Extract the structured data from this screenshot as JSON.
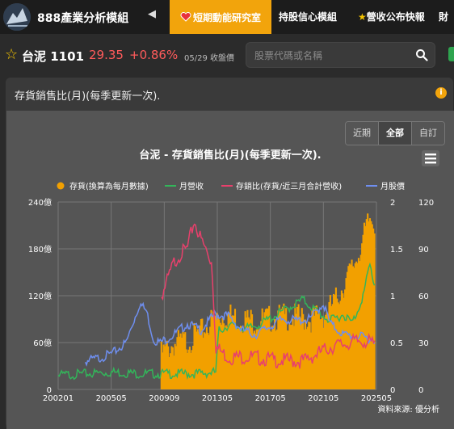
{
  "app": {
    "brand": "888產業分析模組",
    "nav_arrow": "◀"
  },
  "nav": {
    "active_tab": "短期動能研究室",
    "tabs": [
      "持股信心模組",
      "營收公布快報",
      "財"
    ]
  },
  "stock": {
    "name": "台泥 1101",
    "price": "29.35",
    "change": "+0.86%",
    "date": "05/29 收盤價"
  },
  "search": {
    "placeholder": "股票代碼或名稱"
  },
  "panel": {
    "title": "存貨銷售比(月)(每季更新一次)."
  },
  "range_buttons": [
    "近期",
    "全部",
    "自訂"
  ],
  "colors": {
    "inventory": "#f2a000",
    "revenue": "#33b55a",
    "ratio": "#e8406c",
    "price": "#6f8ff0",
    "accent": "#f2a40c"
  },
  "chart_data": {
    "type": "bar+line",
    "title": "台泥 - 存貨銷售比(月)(每季更新一次).",
    "source": "資料來源: 優分析",
    "legend": [
      "存貨(換算為每月數據)",
      "月營收",
      "存銷比(存貨/近三月合計營收)",
      "月股價"
    ],
    "legend_position": "top",
    "x_ticks": [
      "200201",
      "200505",
      "200909",
      "201305",
      "201705",
      "202105",
      "202505"
    ],
    "x_range": [
      2002.0,
      2025.4
    ],
    "left_axis": {
      "ticks": [
        "0",
        "60億",
        "120億",
        "180億",
        "240億"
      ],
      "range": [
        0,
        240
      ],
      "unit": "億"
    },
    "right_axis_1": {
      "ticks": [
        "0",
        "0.5",
        "1",
        "1.5",
        "2"
      ],
      "range": [
        0,
        2
      ]
    },
    "right_axis_2": {
      "ticks": [
        "0",
        "30",
        "60",
        "90",
        "120"
      ],
      "range": [
        0,
        120
      ]
    },
    "grid": true,
    "series": [
      {
        "name": "存貨(換算為每月數據)",
        "axis": "left",
        "type": "bar",
        "points": [
          [
            2009.6,
            45
          ],
          [
            2010.5,
            58
          ],
          [
            2011.5,
            62
          ],
          [
            2012.5,
            72
          ],
          [
            2013.5,
            92
          ],
          [
            2014.5,
            95
          ],
          [
            2015.5,
            90
          ],
          [
            2016.5,
            88
          ],
          [
            2017.5,
            90
          ],
          [
            2018.5,
            93
          ],
          [
            2019.5,
            92
          ],
          [
            2020.5,
            90
          ],
          [
            2021.5,
            95
          ],
          [
            2022.3,
            110
          ],
          [
            2022.9,
            130
          ],
          [
            2023.5,
            150
          ],
          [
            2024.0,
            170
          ],
          [
            2024.5,
            195
          ],
          [
            2024.9,
            218
          ],
          [
            2025.3,
            215
          ]
        ]
      },
      {
        "name": "月營收",
        "axis": "left",
        "type": "line",
        "points": [
          [
            2002.0,
            18
          ],
          [
            2004.0,
            20
          ],
          [
            2006.0,
            22
          ],
          [
            2008.0,
            20
          ],
          [
            2010.0,
            20
          ],
          [
            2012.0,
            20
          ],
          [
            2013.6,
            22
          ],
          [
            2013.8,
            75
          ],
          [
            2014.5,
            82
          ],
          [
            2016.0,
            78
          ],
          [
            2017.0,
            85
          ],
          [
            2018.0,
            95
          ],
          [
            2019.0,
            105
          ],
          [
            2020.0,
            115
          ],
          [
            2021.0,
            100
          ],
          [
            2022.0,
            88
          ],
          [
            2023.0,
            96
          ],
          [
            2023.6,
            85
          ],
          [
            2024.0,
            100
          ],
          [
            2024.5,
            125
          ],
          [
            2024.9,
            160
          ],
          [
            2025.3,
            130
          ]
        ]
      },
      {
        "name": "存銷比(存貨/近三月合計營收)",
        "axis": "right1",
        "type": "line",
        "points": [
          [
            2009.6,
            1.0
          ],
          [
            2010.0,
            1.15
          ],
          [
            2010.5,
            1.35
          ],
          [
            2011.0,
            1.45
          ],
          [
            2011.5,
            1.5
          ],
          [
            2012.0,
            1.8
          ],
          [
            2012.5,
            1.6
          ],
          [
            2013.0,
            1.45
          ],
          [
            2013.3,
            1.35
          ],
          [
            2013.6,
            0.45
          ],
          [
            2014.5,
            0.34
          ],
          [
            2016.0,
            0.35
          ],
          [
            2018.0,
            0.31
          ],
          [
            2020.0,
            0.3
          ],
          [
            2022.0,
            0.45
          ],
          [
            2023.5,
            0.5
          ],
          [
            2024.5,
            0.52
          ],
          [
            2025.3,
            0.48
          ]
        ]
      },
      {
        "name": "月股價",
        "axis": "right2",
        "type": "line",
        "points": [
          [
            2004.0,
            18
          ],
          [
            2005.0,
            20
          ],
          [
            2006.0,
            23
          ],
          [
            2007.0,
            30
          ],
          [
            2007.6,
            45
          ],
          [
            2008.0,
            55
          ],
          [
            2008.5,
            50
          ],
          [
            2009.0,
            32
          ],
          [
            2009.5,
            30
          ],
          [
            2010.5,
            35
          ],
          [
            2011.5,
            42
          ],
          [
            2012.5,
            38
          ],
          [
            2013.5,
            48
          ],
          [
            2014.5,
            47
          ],
          [
            2015.5,
            38
          ],
          [
            2016.5,
            35
          ],
          [
            2017.5,
            40
          ],
          [
            2018.5,
            45
          ],
          [
            2019.5,
            44
          ],
          [
            2020.5,
            45
          ],
          [
            2021.5,
            55
          ],
          [
            2022.0,
            42
          ],
          [
            2023.0,
            35
          ],
          [
            2024.0,
            34
          ],
          [
            2025.3,
            32
          ]
        ]
      }
    ]
  }
}
